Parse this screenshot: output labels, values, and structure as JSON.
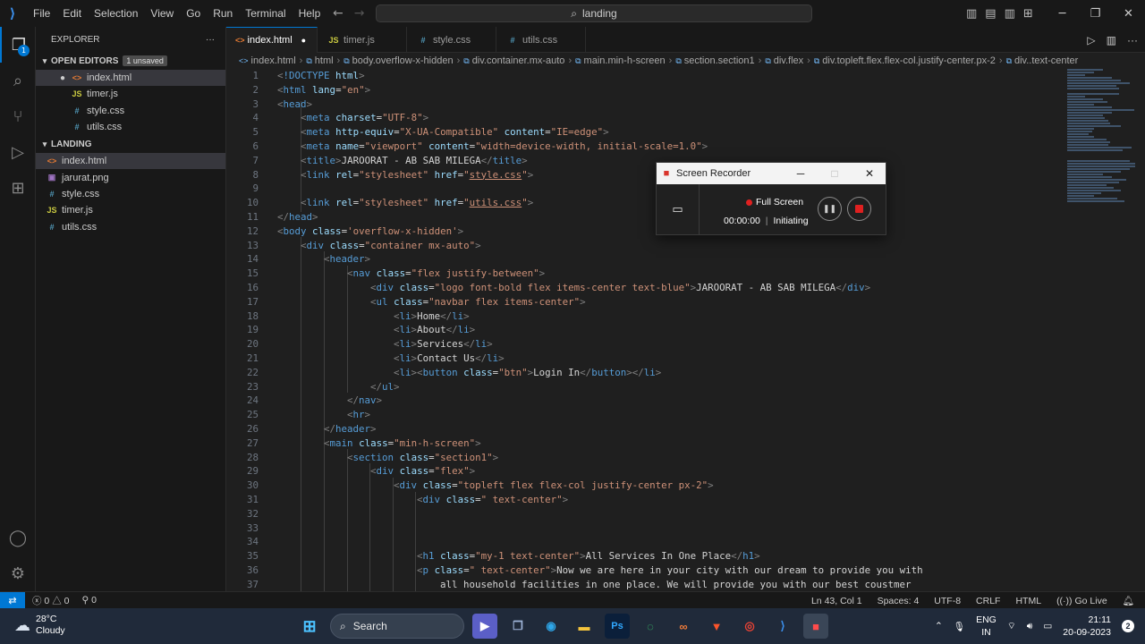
{
  "window": {
    "menu": [
      "File",
      "Edit",
      "Selection",
      "View",
      "Go",
      "Run",
      "Terminal",
      "Help"
    ],
    "command_center": "landing"
  },
  "sidebar": {
    "title": "EXPLORER",
    "open_editors_label": "OPEN EDITORS",
    "unsaved_badge": "1 unsaved",
    "open_editors": [
      {
        "name": "index.html",
        "icon": "html-file-icon",
        "dirty": true
      },
      {
        "name": "timer.js",
        "icon": "js-file-icon"
      },
      {
        "name": "style.css",
        "icon": "css-file-icon"
      },
      {
        "name": "utils.css",
        "icon": "css-file-icon"
      }
    ],
    "folder_label": "LANDING",
    "files": [
      {
        "name": "index.html",
        "icon": "html-file-icon"
      },
      {
        "name": "jarurat.png",
        "icon": "image-file-icon"
      },
      {
        "name": "style.css",
        "icon": "css-file-icon"
      },
      {
        "name": "timer.js",
        "icon": "js-file-icon"
      },
      {
        "name": "utils.css",
        "icon": "css-file-icon"
      }
    ],
    "explorer_badge": "1"
  },
  "tabs": [
    {
      "label": "index.html",
      "active": true,
      "dirty": true
    },
    {
      "label": "timer.js"
    },
    {
      "label": "style.css"
    },
    {
      "label": "utils.css"
    }
  ],
  "breadcrumbs": [
    "index.html",
    "html",
    "body.overflow-x-hidden",
    "div.container.mx-auto",
    "main.min-h-screen",
    "section.section1",
    "div.flex",
    "div.topleft.flex.flex-col.justify-center.px-2",
    "div..text-center"
  ],
  "editor": {
    "line_numbers": [
      "1",
      "2",
      "3",
      "4",
      "5",
      "6",
      "7",
      "8",
      "9",
      "10",
      "11",
      "12",
      "13",
      "14",
      "15",
      "16",
      "17",
      "18",
      "19",
      "20",
      "21",
      "22",
      "23",
      "24",
      "25",
      "26",
      "27",
      "28",
      "29",
      "30",
      "31",
      "32",
      "33",
      "34",
      "35",
      "36",
      "37"
    ]
  },
  "recorder": {
    "title": "Screen Recorder",
    "mode": "Full Screen",
    "time": "00:00:00",
    "state": "Initiating"
  },
  "statusbar": {
    "errors": "0",
    "warnings": "0",
    "ports": "0",
    "position": "Ln 43, Col 1",
    "spaces": "Spaces: 4",
    "encoding": "UTF-8",
    "eol": "CRLF",
    "language": "HTML",
    "golive": "Go Live"
  },
  "taskbar": {
    "temperature": "28°C",
    "weather": "Cloudy",
    "search_label": "Search",
    "lang": "ENG",
    "region": "IN",
    "time": "21:11",
    "date": "20-09-2023",
    "notifications": "2"
  },
  "colors": {
    "accent": "#0078d4",
    "tag": "#569cd6",
    "attr": "#9cdcfe",
    "string": "#ce9178"
  }
}
